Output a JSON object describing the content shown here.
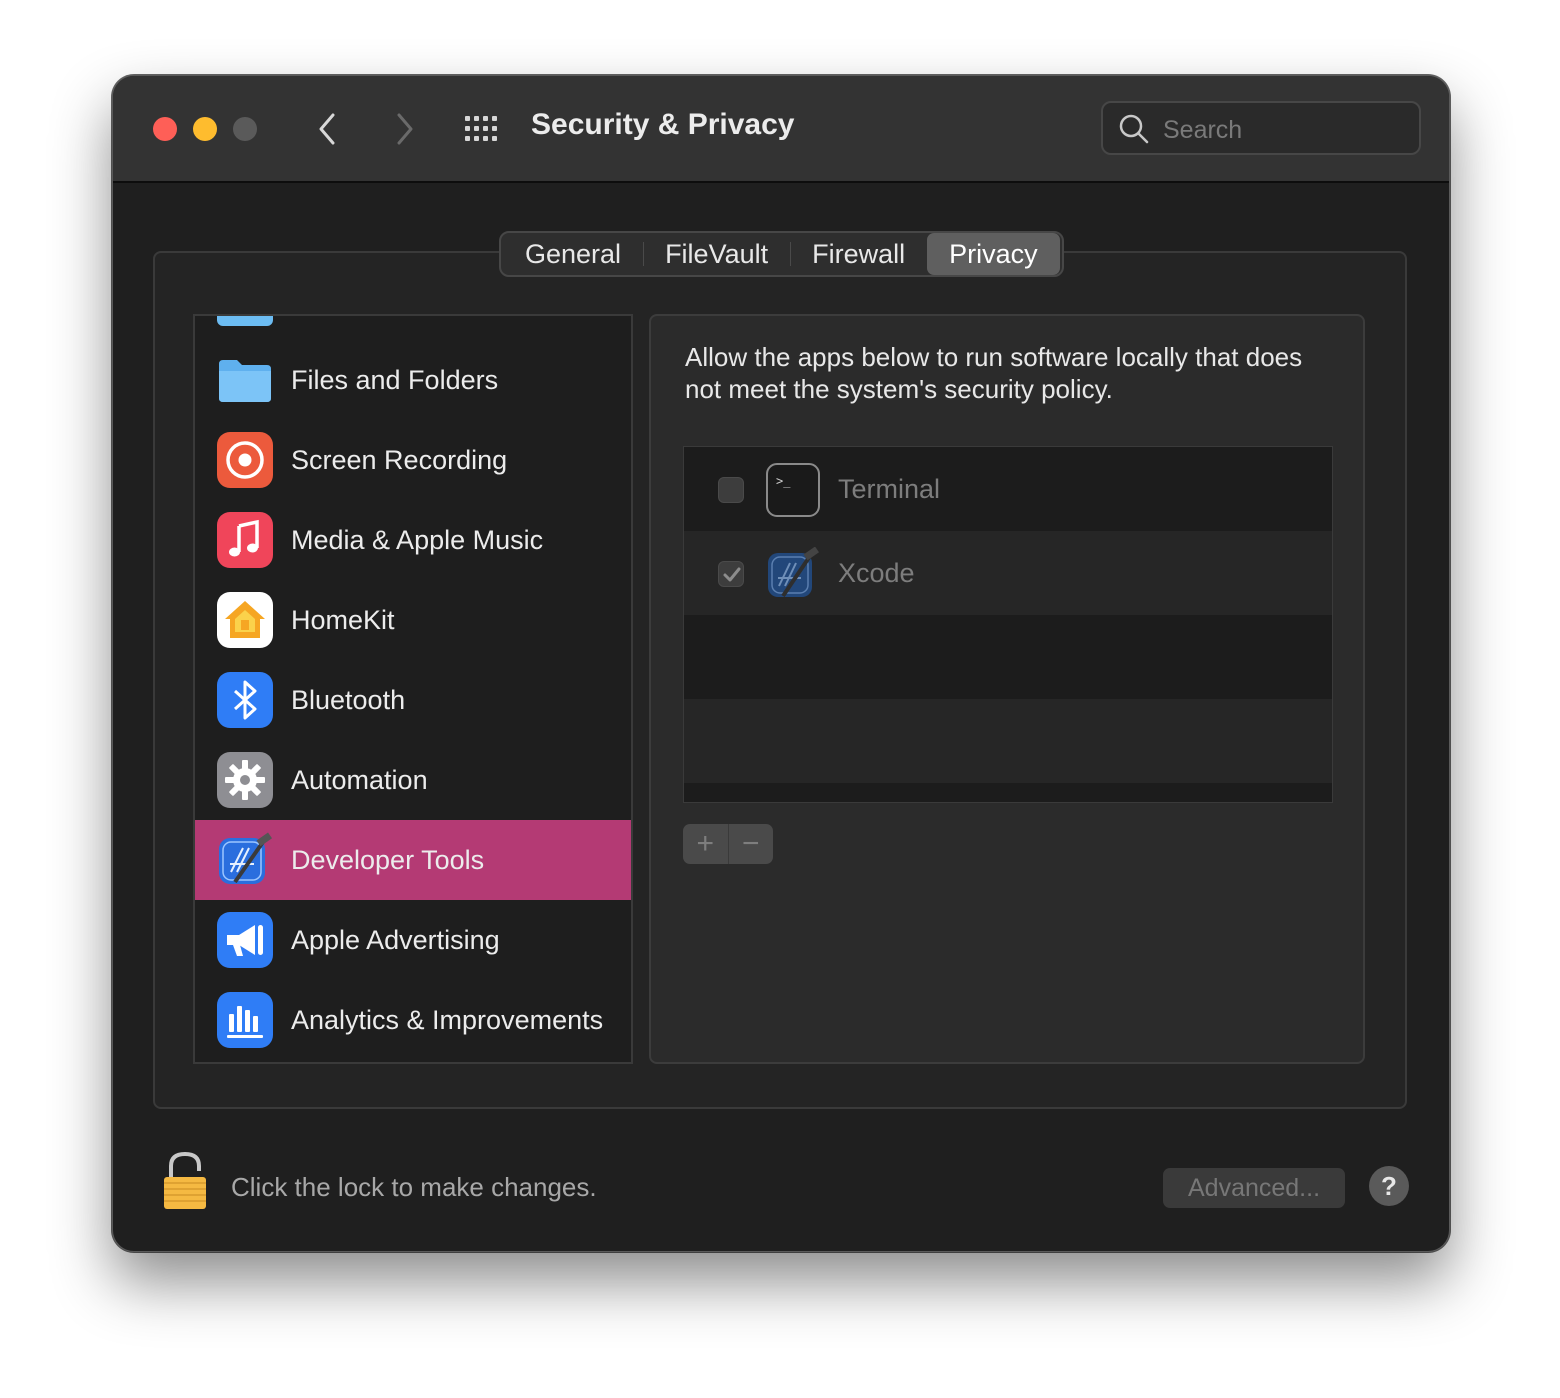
{
  "window": {
    "title": "Security & Privacy",
    "search_placeholder": "Search"
  },
  "tabs": [
    {
      "label": "General",
      "active": false
    },
    {
      "label": "FileVault",
      "active": false
    },
    {
      "label": "Firewall",
      "active": false
    },
    {
      "label": "Privacy",
      "active": true
    }
  ],
  "sidebar": {
    "items": [
      {
        "label": "Files and Folders",
        "icon": "folder-icon"
      },
      {
        "label": "Screen Recording",
        "icon": "screen-recording-icon"
      },
      {
        "label": "Media & Apple Music",
        "icon": "music-note-icon"
      },
      {
        "label": "HomeKit",
        "icon": "homekit-icon"
      },
      {
        "label": "Bluetooth",
        "icon": "bluetooth-icon"
      },
      {
        "label": "Automation",
        "icon": "gear-icon"
      },
      {
        "label": "Developer Tools",
        "icon": "developer-tools-icon",
        "selected": true
      },
      {
        "label": "Apple Advertising",
        "icon": "megaphone-icon"
      },
      {
        "label": "Analytics & Improvements",
        "icon": "bar-chart-icon"
      }
    ]
  },
  "content": {
    "description": "Allow the apps below to run software locally that does not meet the system's security policy.",
    "apps": [
      {
        "name": "Terminal",
        "checked": false,
        "icon": "terminal-icon"
      },
      {
        "name": "Xcode",
        "checked": true,
        "icon": "xcode-icon"
      }
    ],
    "add_label": "+",
    "remove_label": "−"
  },
  "footer": {
    "lock_text": "Click the lock to make changes.",
    "advanced_label": "Advanced...",
    "help_label": "?"
  },
  "colors": {
    "selection": "#b43a74",
    "window_bg": "#1f1f1f",
    "titlebar_bg": "#333333"
  }
}
